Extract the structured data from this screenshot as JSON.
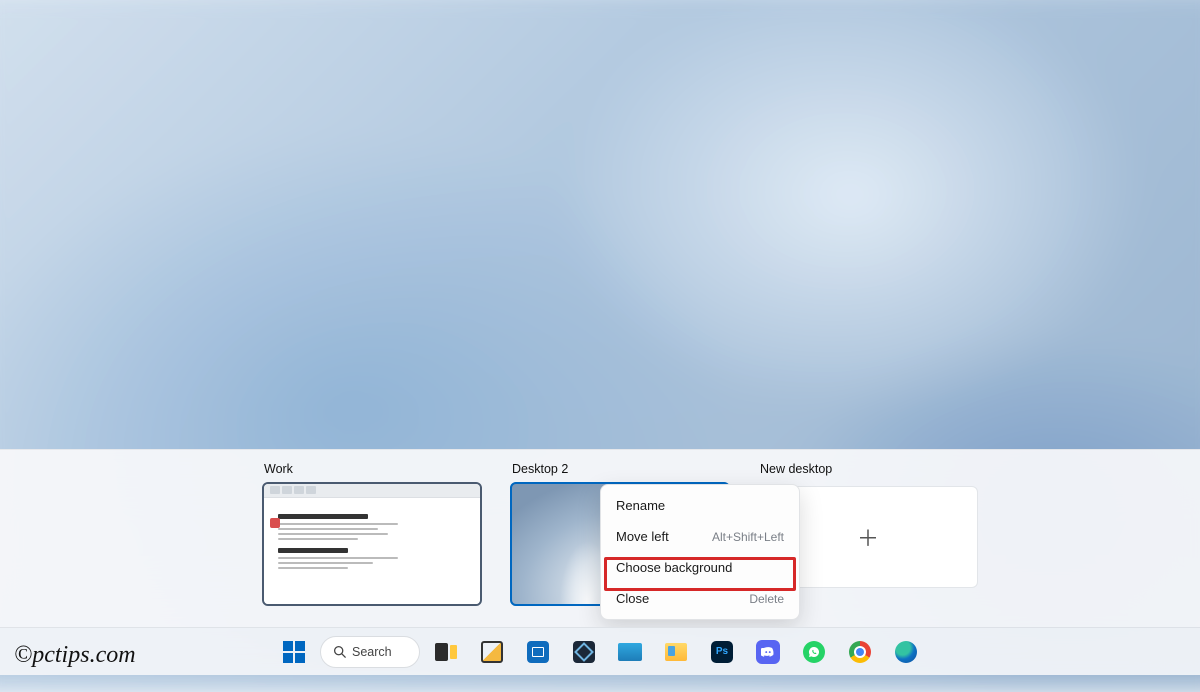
{
  "watermark": "©pctips.com",
  "taskview": {
    "desktops": [
      {
        "label": "Work"
      },
      {
        "label": "Desktop 2"
      }
    ],
    "new_desktop_label": "New desktop"
  },
  "context_menu": {
    "items": [
      {
        "label": "Rename",
        "shortcut": ""
      },
      {
        "label": "Move left",
        "shortcut": "Alt+Shift+Left"
      },
      {
        "label": "Choose background",
        "shortcut": ""
      },
      {
        "label": "Close",
        "shortcut": "Delete"
      }
    ],
    "highlighted_index": 2
  },
  "taskbar": {
    "search_label": "Search",
    "apps": [
      {
        "id": "start",
        "name": "Start"
      },
      {
        "id": "search",
        "name": "Search"
      },
      {
        "id": "task-view",
        "name": "Task View"
      },
      {
        "id": "snipping-tool",
        "name": "Snipping Tool"
      },
      {
        "id": "microsoft-store",
        "name": "Microsoft Store"
      },
      {
        "id": "virtualbox",
        "name": "VirtualBox"
      },
      {
        "id": "windows-sandbox",
        "name": "Windows Sandbox"
      },
      {
        "id": "file-explorer",
        "name": "File Explorer"
      },
      {
        "id": "photoshop",
        "name": "Adobe Photoshop",
        "badge": "Ps"
      },
      {
        "id": "discord",
        "name": "Discord"
      },
      {
        "id": "whatsapp",
        "name": "WhatsApp"
      },
      {
        "id": "chrome",
        "name": "Google Chrome"
      },
      {
        "id": "edge",
        "name": "Microsoft Edge"
      }
    ]
  }
}
